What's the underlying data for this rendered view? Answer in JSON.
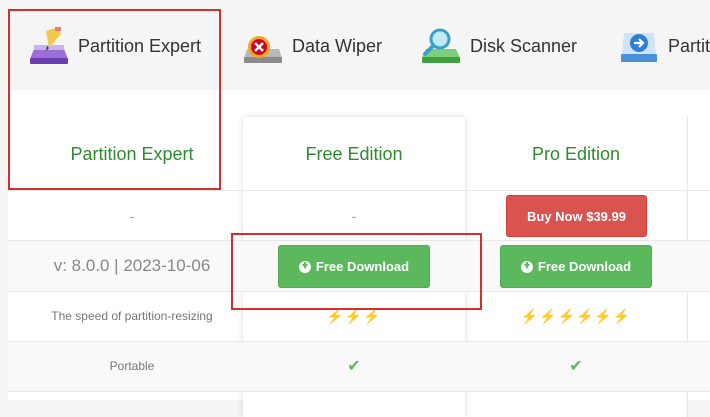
{
  "tabs": [
    {
      "label": "Partition Expert",
      "icon": "partition-expert-icon"
    },
    {
      "label": "Data Wiper",
      "icon": "data-wiper-icon"
    },
    {
      "label": "Disk Scanner",
      "icon": "disk-scanner-icon"
    },
    {
      "label": "Partit",
      "icon": "partition-icon"
    }
  ],
  "table": {
    "headers": [
      "Partition Expert",
      "Free Edition",
      "Pro Edition"
    ],
    "price_row": {
      "left": "-",
      "free": "-",
      "pro_button": "Buy Now $39.99"
    },
    "download_row": {
      "version": "v: 8.0.0 | 2023-10-06",
      "free_button": "Free Download",
      "pro_button": "Free Download"
    },
    "speed_row": {
      "label": "The speed of partition-resizing",
      "free": "⚡⚡⚡",
      "pro": "⚡⚡⚡⚡⚡⚡"
    },
    "portable_row": {
      "label": "Portable",
      "free": "✔",
      "pro": "✔"
    }
  },
  "colors": {
    "accent_green": "#5cb85c",
    "buy_red": "#d9534f",
    "highlight_red": "#d32f2f",
    "heading_green": "#2e8b2e"
  }
}
